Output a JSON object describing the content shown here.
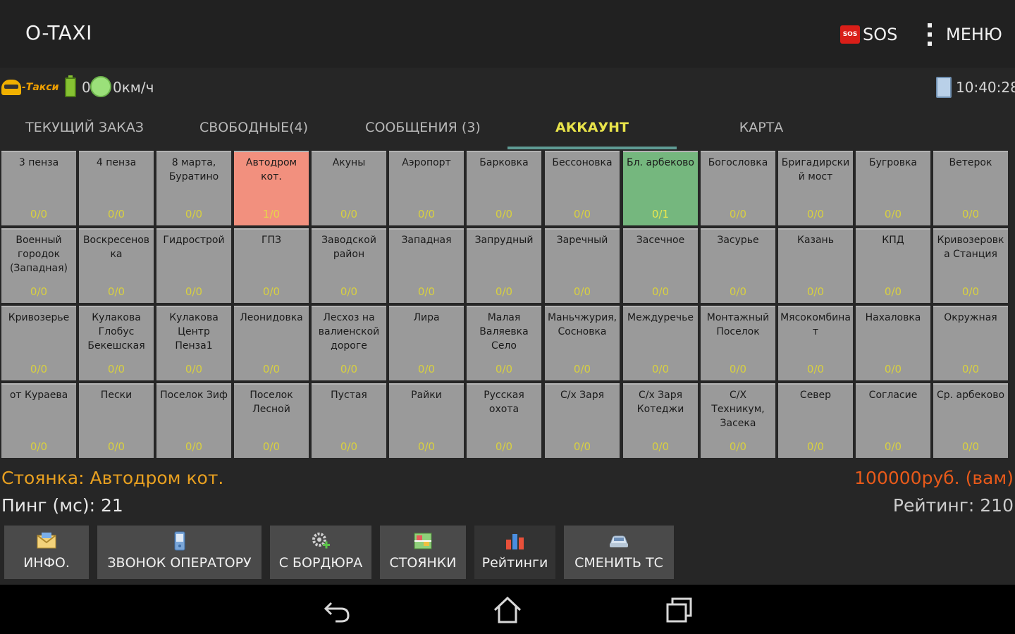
{
  "app": {
    "title": "O-TAXI",
    "sos_label": "SOS",
    "sos_badge": "SOS",
    "menu_label": "МЕНЮ"
  },
  "status": {
    "logo_text": "-Такси",
    "battery": "0",
    "speed": "0км/ч",
    "time": "10:40:28"
  },
  "tabs": [
    {
      "label": "ТЕКУЩИЙ ЗАКАЗ",
      "active": false
    },
    {
      "label": "СВОБОДНЫЕ(4)",
      "active": false
    },
    {
      "label": "СООБЩЕНИЯ (3)",
      "active": false
    },
    {
      "label": "АККАУНТ",
      "active": true
    },
    {
      "label": "КАРТА",
      "active": false
    }
  ],
  "stands": [
    {
      "name": "3 пенза",
      "count": "0/0",
      "state": "normal"
    },
    {
      "name": "4 пенза",
      "count": "0/0",
      "state": "normal"
    },
    {
      "name": "8 марта, Буратино",
      "count": "0/0",
      "state": "normal"
    },
    {
      "name": "Автодром кот.",
      "count": "1/0",
      "state": "red"
    },
    {
      "name": "Акуны",
      "count": "0/0",
      "state": "normal"
    },
    {
      "name": "Аэропорт",
      "count": "0/0",
      "state": "normal"
    },
    {
      "name": "Барковка",
      "count": "0/0",
      "state": "normal"
    },
    {
      "name": "Бессоновка",
      "count": "0/0",
      "state": "normal"
    },
    {
      "name": "Бл. арбеково",
      "count": "0/1",
      "state": "green"
    },
    {
      "name": "Богословка",
      "count": "0/0",
      "state": "normal"
    },
    {
      "name": "Бригадирский мост",
      "count": "0/0",
      "state": "normal"
    },
    {
      "name": "Бугровка",
      "count": "0/0",
      "state": "normal"
    },
    {
      "name": "Ветерок",
      "count": "0/0",
      "state": "normal"
    },
    {
      "name": "Военный городок (Западная)",
      "count": "0/0",
      "state": "normal"
    },
    {
      "name": "Воскресеновка",
      "count": "0/0",
      "state": "normal"
    },
    {
      "name": "Гидрострой",
      "count": "0/0",
      "state": "normal"
    },
    {
      "name": "ГПЗ",
      "count": "0/0",
      "state": "normal"
    },
    {
      "name": "Заводской район",
      "count": "0/0",
      "state": "normal"
    },
    {
      "name": "Западная",
      "count": "0/0",
      "state": "normal"
    },
    {
      "name": "Запрудный",
      "count": "0/0",
      "state": "normal"
    },
    {
      "name": "Заречный",
      "count": "0/0",
      "state": "normal"
    },
    {
      "name": "Засечное",
      "count": "0/0",
      "state": "normal"
    },
    {
      "name": "Засурье",
      "count": "0/0",
      "state": "normal"
    },
    {
      "name": "Казань",
      "count": "0/0",
      "state": "normal"
    },
    {
      "name": "КПД",
      "count": "0/0",
      "state": "normal"
    },
    {
      "name": "Кривозеровка Станция",
      "count": "0/0",
      "state": "normal"
    },
    {
      "name": "Кривозерье",
      "count": "0/0",
      "state": "normal"
    },
    {
      "name": "Кулакова Глобус Бекешская",
      "count": "0/0",
      "state": "normal"
    },
    {
      "name": "Кулакова Центр Пенза1",
      "count": "0/0",
      "state": "normal"
    },
    {
      "name": "Леонидовка",
      "count": "0/0",
      "state": "normal"
    },
    {
      "name": "Лесхоз на валиенской дороге",
      "count": "0/0",
      "state": "normal"
    },
    {
      "name": "Лира",
      "count": "0/0",
      "state": "normal"
    },
    {
      "name": "Малая Валяевка Село",
      "count": "0/0",
      "state": "normal"
    },
    {
      "name": "Маньчжурия, Сосновка",
      "count": "0/0",
      "state": "normal"
    },
    {
      "name": "Междуречье",
      "count": "0/0",
      "state": "normal"
    },
    {
      "name": "Монтажный Поселок",
      "count": "0/0",
      "state": "normal"
    },
    {
      "name": "Мясокомбинат",
      "count": "0/0",
      "state": "normal"
    },
    {
      "name": "Нахаловка",
      "count": "0/0",
      "state": "normal"
    },
    {
      "name": "Окружная",
      "count": "0/0",
      "state": "normal"
    },
    {
      "name": "от Кураева",
      "count": "0/0",
      "state": "normal"
    },
    {
      "name": "Пески",
      "count": "0/0",
      "state": "normal"
    },
    {
      "name": "Поселок Зиф",
      "count": "0/0",
      "state": "normal"
    },
    {
      "name": "Поселок Лесной",
      "count": "0/0",
      "state": "normal"
    },
    {
      "name": "Пустая",
      "count": "0/0",
      "state": "normal"
    },
    {
      "name": "Райки",
      "count": "0/0",
      "state": "normal"
    },
    {
      "name": "Русская охота",
      "count": "0/0",
      "state": "normal"
    },
    {
      "name": "С/х Заря",
      "count": "0/0",
      "state": "normal"
    },
    {
      "name": "С/х Заря Котеджи",
      "count": "0/0",
      "state": "normal"
    },
    {
      "name": "С/Х Техникум, Засека",
      "count": "0/0",
      "state": "normal"
    },
    {
      "name": "Север",
      "count": "0/0",
      "state": "normal"
    },
    {
      "name": "Согласие",
      "count": "0/0",
      "state": "normal"
    },
    {
      "name": "Ср. арбеково",
      "count": "0/0",
      "state": "normal"
    }
  ],
  "info": {
    "stand": "Стоянка: Автодром кот.",
    "ping": "Пинг (мс): 21",
    "balance": "100000руб. (вам)",
    "rating": "Рейтинг: 210"
  },
  "actions": [
    {
      "label": "ИНФО.",
      "icon": "envelope-icon"
    },
    {
      "label": "ЗВОНОК ОПЕРАТОРУ",
      "icon": "phone-icon"
    },
    {
      "label": "С БОРДЮРА",
      "icon": "gear-plus-icon"
    },
    {
      "label": "СТОЯНКИ",
      "icon": "map-icon"
    },
    {
      "label": "Рейтинги",
      "icon": "bar-chart-icon"
    },
    {
      "label": "СМЕНИТЬ ТС",
      "icon": "car-icon"
    }
  ],
  "colors": {
    "accent": "#e8e34a",
    "stand_red": "#f2907e",
    "stand_green": "#75b77e",
    "balance": "#e85a1a",
    "stand_text": "#e8a020"
  }
}
